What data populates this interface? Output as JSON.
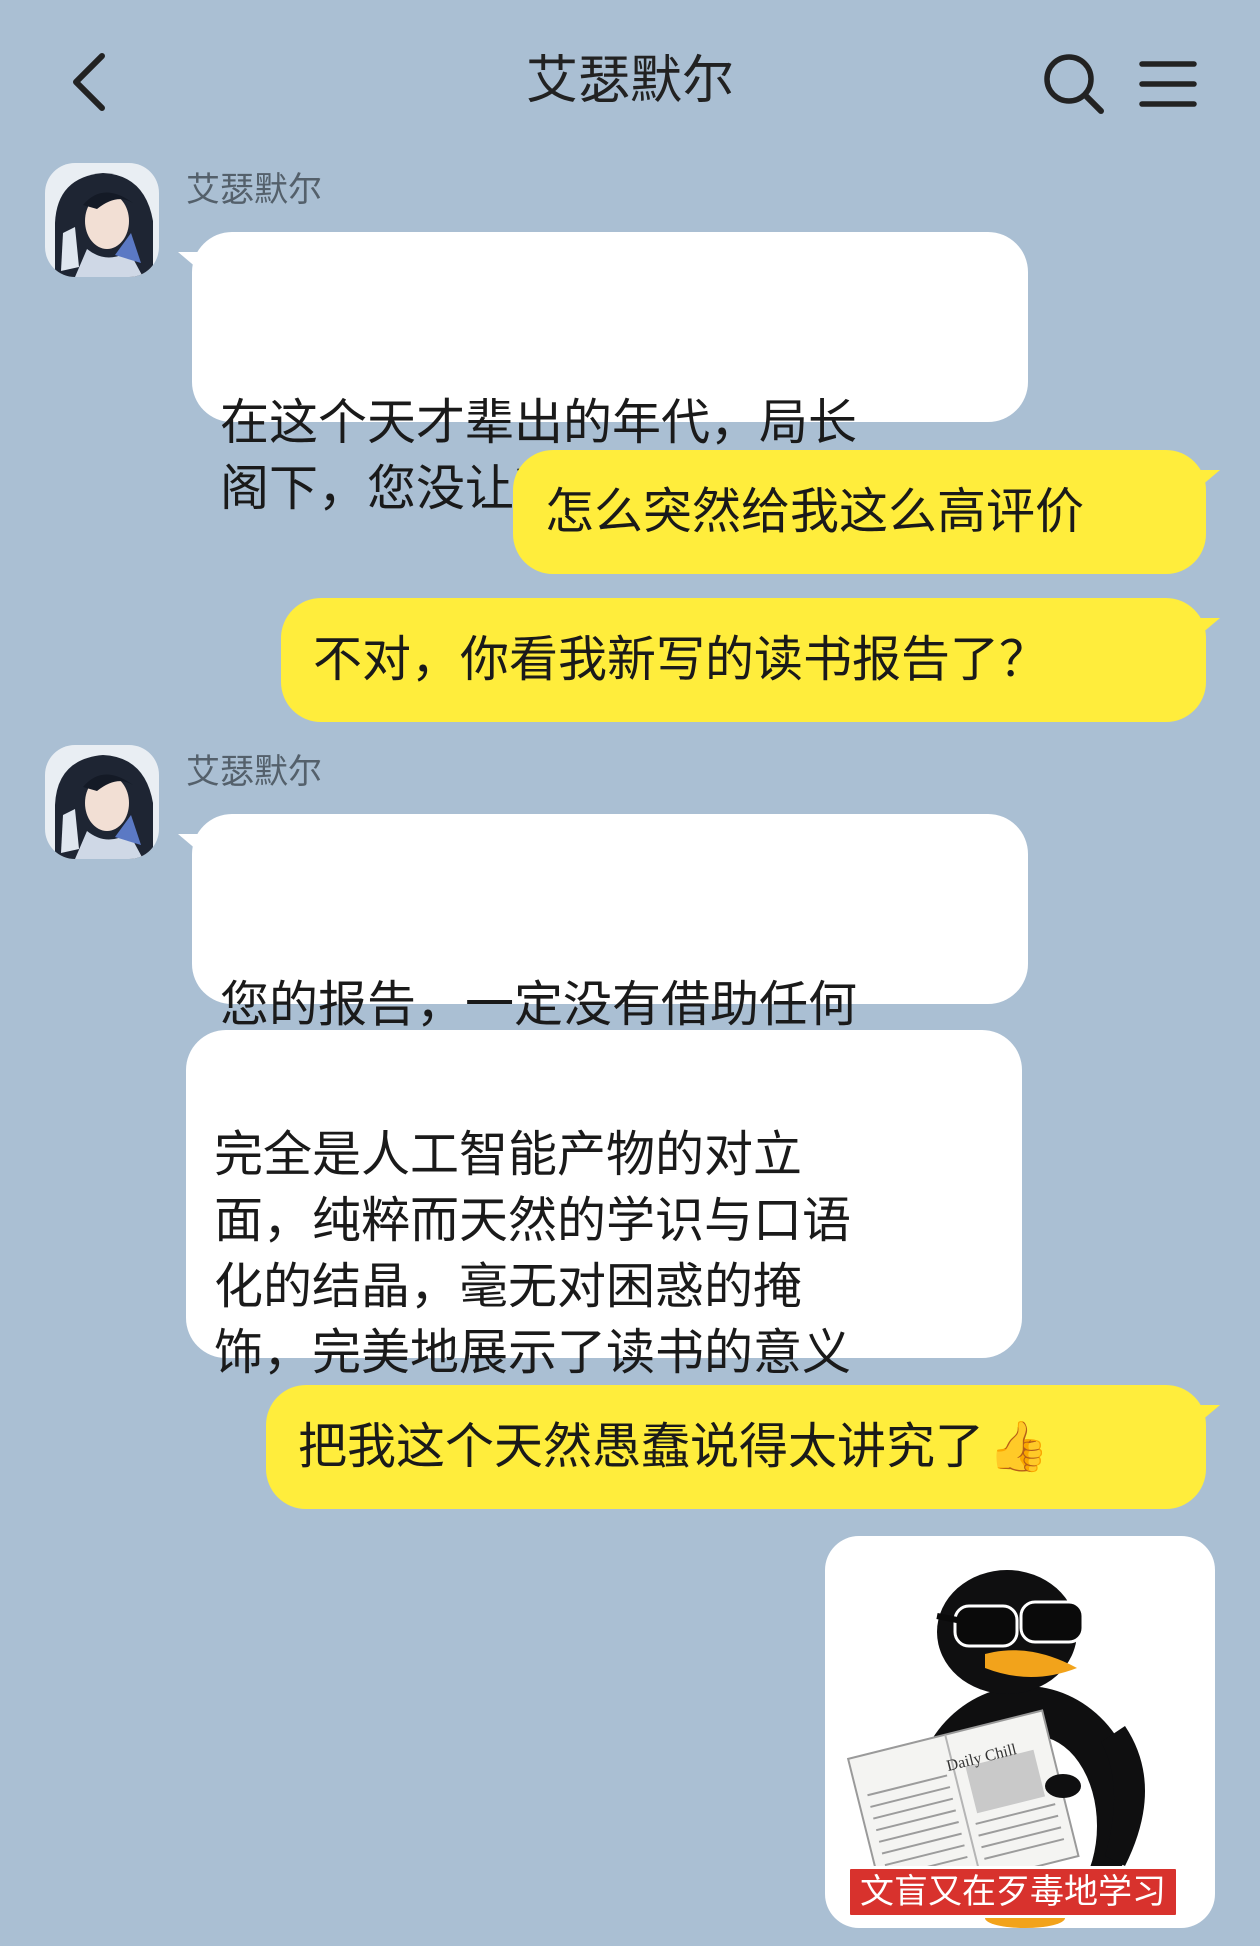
{
  "header": {
    "title": "艾瑟默尔"
  },
  "messages": {
    "m1": {
      "sender": "艾瑟默尔",
      "text": "在这个天才辈出的年代，局长\n阁下，您没让我失望"
    },
    "m2": {
      "text": "怎么突然给我这么高评价"
    },
    "m3": {
      "text": "不对，你看我新写的读书报告了？"
    },
    "m4": {
      "sender": "艾瑟默尔",
      "text": "您的报告，一定没有借助任何\n人工智能的辅助，非常有趣"
    },
    "m5": {
      "text": "完全是人工智能产物的对立\n面，纯粹而天然的学识与口语\n化的结晶，毫无对困惑的掩\n饰，完美地展示了读书的意义"
    },
    "m6": {
      "text": "把我这个天然愚蠢说得太讲究了",
      "emoji": "👍"
    },
    "m7": {
      "sticker_caption": "文盲又在歹毒地学习",
      "newspaper_name": "Daily Chill"
    }
  },
  "icons": {
    "back": "chevron-left-icon",
    "search": "search-icon",
    "menu": "menu-icon",
    "thumbs_up": "thumbs-up-emoji"
  },
  "colors": {
    "background": "#aabfd3",
    "incoming_bubble": "#ffffff",
    "outgoing_bubble": "#ffed3c",
    "caption_bg": "#d8322d"
  }
}
